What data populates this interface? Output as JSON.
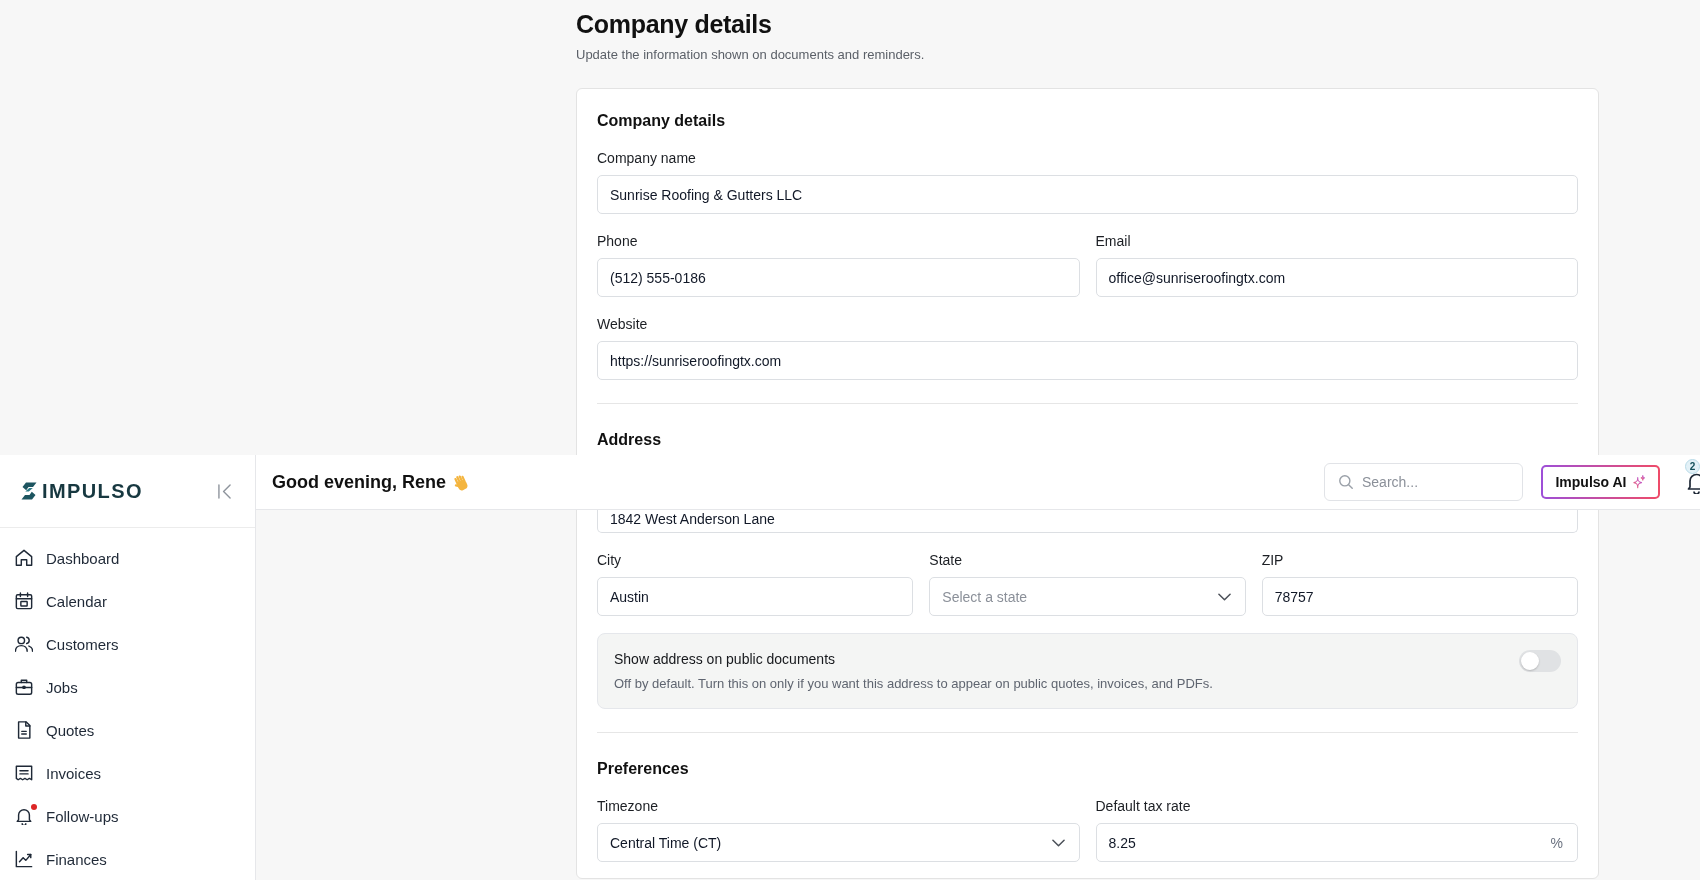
{
  "page_header": {
    "title": "Company details",
    "subtitle": "Update the information shown on documents and reminders."
  },
  "sections": [
    {
      "heading": "Company details",
      "rows": [
        [
          {
            "kind": "text",
            "label": "Company name",
            "value": "Sunrise Roofing & Gutters LLC"
          }
        ],
        [
          {
            "kind": "text",
            "label": "Phone",
            "value": "(512) 555-0186"
          },
          {
            "kind": "text",
            "label": "Email",
            "value": "office@sunriseroofingtx.com"
          }
        ],
        [
          {
            "kind": "text",
            "label": "Website",
            "value": "https://sunriseroofingtx.com"
          }
        ]
      ]
    },
    {
      "heading": "Address",
      "rows": [
        [
          {
            "kind": "text",
            "value": "1842 West Anderson Lane"
          }
        ],
        [
          {
            "kind": "text",
            "label": "City",
            "value": "Austin"
          },
          {
            "kind": "select",
            "label": "State",
            "placeholder": "Select a state"
          },
          {
            "kind": "text",
            "label": "ZIP",
            "value": "78757"
          }
        ]
      ],
      "toggle": {
        "title": "Show address on public documents",
        "description": "Off by default. Turn this on only if you want this address to appear on public quotes, invoices, and PDFs.",
        "on": false
      }
    },
    {
      "heading": "Preferences",
      "rows": [
        [
          {
            "kind": "select",
            "label": "Timezone",
            "value": "Central Time (CT)"
          },
          {
            "kind": "unit",
            "label": "Default tax rate",
            "value": "8.25",
            "suffix": "%"
          }
        ]
      ]
    }
  ],
  "topbar": {
    "greeting": "Good evening, Rene",
    "search": {
      "placeholder": "Search..."
    },
    "ai_button": "Impulso AI",
    "notifications": {
      "count": "2"
    }
  },
  "sidebar": {
    "logo": "IMPULSO",
    "items": [
      {
        "label": "Dashboard",
        "selected": false,
        "alert": false
      },
      {
        "label": "Calendar",
        "selected": false,
        "alert": false
      },
      {
        "label": "Customers",
        "selected": false,
        "alert": false
      },
      {
        "label": "Jobs",
        "selected": false,
        "alert": false
      },
      {
        "label": "Quotes",
        "selected": false,
        "alert": false
      },
      {
        "label": "Invoices",
        "selected": false,
        "alert": false
      },
      {
        "label": "Follow-ups",
        "selected": false,
        "alert": true
      },
      {
        "label": "Finances",
        "selected": false,
        "alert": false
      }
    ]
  }
}
